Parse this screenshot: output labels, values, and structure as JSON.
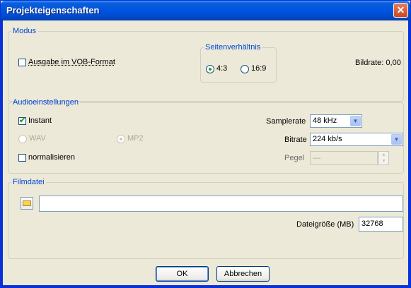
{
  "window": {
    "title": "Projekteigenschaften",
    "close_symbol": "✕"
  },
  "modus": {
    "legend": "Modus",
    "vob_label": "Ausgabe im VOB-Format",
    "vob_checked": false,
    "aspect": {
      "legend": "Seitenverhältnis",
      "opt1": "4:3",
      "opt2": "16:9",
      "selected": "4:3"
    },
    "bildrate": "Bildrate: 0,00"
  },
  "audio": {
    "legend": "Audioeinstellungen",
    "instant_label": "Instant",
    "instant_checked": true,
    "wav_label": "WAV",
    "mp2_label": "MP2",
    "normalisieren_label": "normalisieren",
    "normalisieren_checked": false,
    "samplerate_label": "Samplerate",
    "samplerate_value": "48 kHz",
    "bitrate_label": "Bitrate",
    "bitrate_value": "224 kb/s",
    "pegel_label": "Pegel",
    "pegel_value": "—"
  },
  "film": {
    "legend": "Filmdatei",
    "path_value": "",
    "dateigroesse_label": "Dateigröße (MB)",
    "dateigroesse_value": "32768"
  },
  "buttons": {
    "ok": "OK",
    "cancel": "Abbrechen"
  },
  "colors": {
    "titlebar": "#0054e3",
    "legend_text": "#0046d5",
    "dialog_bg": "#ece9d8",
    "check": "#21a121"
  }
}
